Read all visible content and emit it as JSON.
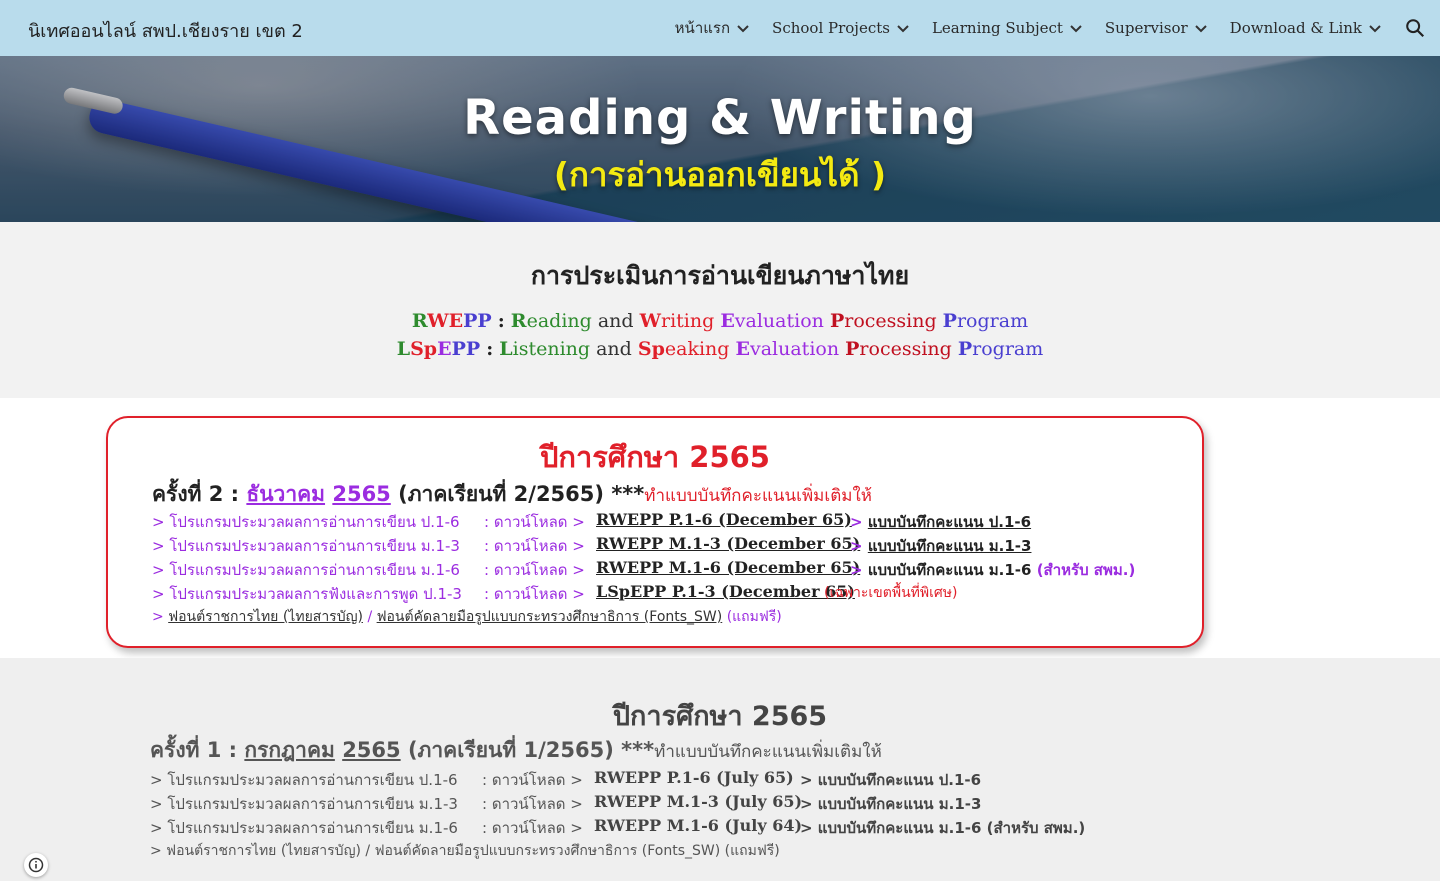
{
  "site": {
    "title": "นิเทศออนไลน์ สพป.เชียงราย เขต 2"
  },
  "nav": {
    "items": [
      {
        "label": "หน้าแรก"
      },
      {
        "label": "School Projects"
      },
      {
        "label": "Learning Subject"
      },
      {
        "label": "Supervisor"
      },
      {
        "label": "Download & Link"
      }
    ]
  },
  "hero": {
    "title": "Reading & Writing",
    "subtitle": "(การอ่านออกเขียนได้ )"
  },
  "assessment": {
    "title": "การประเมินการอ่านเขียนภาษาไทย",
    "rwepp": {
      "abbr_r": "R",
      "abbr_we": "WE",
      "abbr_pp": "PP",
      "colon": ":",
      "w1_initial": "R",
      "w1_rest": "eading",
      "and": "and",
      "w2_initial": "W",
      "w2_rest": "riting",
      "w3_initial": "E",
      "w3_rest": "valuation",
      "w4_initial": "P",
      "w4_rest": "rocessing",
      "w5_initial": "P",
      "w5_rest": "rogram"
    },
    "lsepp": {
      "abbr_l": "L",
      "abbr_sp": "Sp",
      "abbr_e": "E",
      "abbr_pp": "PP",
      "colon": ":",
      "w1_initial": "L",
      "w1_rest": "istening",
      "and": "and",
      "w2_initial": "Sp",
      "w2_rest": "eaking",
      "w3_initial": "E",
      "w3_rest": "valuation",
      "w4_initial": "P",
      "w4_rest": "rocessing",
      "w5_initial": "P",
      "w5_rest": "rogram"
    }
  },
  "year2565_round2": {
    "year": "ปีการศึกษา 2565",
    "round_prefix": "ครั้งที่ 2 :",
    "month_link": "ธันวาคม",
    "year_link": "2565",
    "term": "(ภาคเรียนที่ 2/2565)",
    "stars": "***",
    "note": "ทำแบบบันทึกคะแนนเพิ่มเติมให้",
    "rows": [
      {
        "program": "> โปรแกรมประมวลผลการอ่านการเขียน ป.1-6",
        "download": ": ดาวน์โหลด >",
        "link": "RWEPP P.1-6 (December 65)",
        "record_prefix": ">",
        "record": "แบบบันทึกคะแนน ป.1-6",
        "extra": ""
      },
      {
        "program": "> โปรแกรมประมวลผลการอ่านการเขียน ม.1-3",
        "download": ": ดาวน์โหลด >",
        "link": "RWEPP M.1-3 (December 65)",
        "record_prefix": ">",
        "record": "แบบบันทึกคะแนน ม.1-3",
        "extra": ""
      },
      {
        "program": "> โปรแกรมประมวลผลการอ่านการเขียน ม.1-6",
        "download": ": ดาวน์โหลด >",
        "link": "RWEPP M.1-6 (December 65)",
        "record_prefix": ">",
        "record": "แบบบันทึกคะแนน ม.1-6",
        "extra": "(สำหรับ สพม.)"
      },
      {
        "program": "> โปรแกรมประมวลผลการฟังและการพูด ป.1-3",
        "download": ": ดาวน์โหลด >",
        "link": "LSpEPP P.1-3 (December 65)",
        "record_prefix": "",
        "record": "",
        "extra": "(เฉพาะเขตพื้นที่พิเศษ)"
      }
    ],
    "fonts_prefix": ">",
    "font1": "ฟอนต์ราชการไทย (ไทยสารบัญ)",
    "sep": "/",
    "font2": "ฟอนต์คัดลายมือรูปแบบกระทรวงศึกษาธิการ (Fonts_SW)",
    "free": "(แถมฟรี)"
  },
  "year2565_round1": {
    "year": "ปีการศึกษา 2565",
    "round_prefix": "ครั้งที่ 1 :",
    "month_link": "กรกฎาคม",
    "year_link": "2565",
    "term": "(ภาคเรียนที่ 1/2565)",
    "stars": "***",
    "note": "ทำแบบบันทึกคะแนนเพิ่มเติมให้",
    "rows": [
      {
        "program": "> โปรแกรมประมวลผลการอ่านการเขียน ป.1-6",
        "download": ": ดาวน์โหลด >",
        "link": "RWEPP P.1-6 (July 65)",
        "record": "> แบบบันทึกคะแนน ป.1-6"
      },
      {
        "program": "> โปรแกรมประมวลผลการอ่านการเขียน ม.1-3",
        "download": ": ดาวน์โหลด >",
        "link": "RWEPP M.1-3 (July 65)",
        "record": "> แบบบันทึกคะแนน ม.1-3"
      },
      {
        "program": "> โปรแกรมประมวลผลการอ่านการเขียน ม.1-6",
        "download": ": ดาวน์โหลด >",
        "link": "RWEPP M.1-6 (July 64)",
        "record": "> แบบบันทึกคะแนน ม.1-6 (สำหรับ สพม.)"
      }
    ],
    "fonts_line": "> ฟอนต์ราชการไทย (ไทยสารบัญ)  / ฟอนต์คัดลายมือรูปแบบกระทรวงศึกษาธิการ (Fonts_SW)  (แถมฟรี)"
  },
  "colors": {
    "topbar": "#b9dcec",
    "red": "#e0202a",
    "purple": "#9b2ce0",
    "green": "#2e8b2e",
    "blue": "#4a3fd0",
    "yellow": "#f4ea12"
  }
}
